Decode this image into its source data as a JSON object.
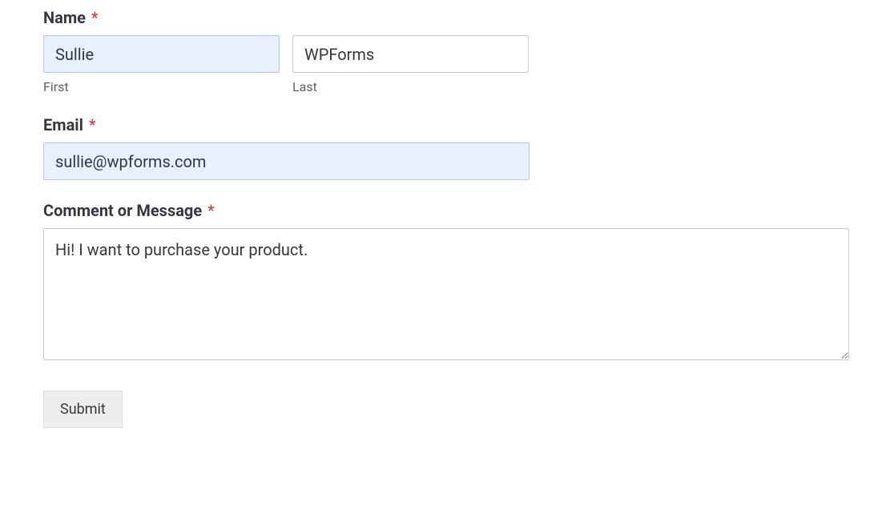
{
  "form": {
    "name": {
      "label": "Name",
      "required_marker": "*",
      "first": {
        "value": "Sullie",
        "sublabel": "First"
      },
      "last": {
        "value": "WPForms",
        "sublabel": "Last"
      }
    },
    "email": {
      "label": "Email",
      "required_marker": "*",
      "value": "sullie@wpforms.com"
    },
    "comment": {
      "label": "Comment or Message",
      "required_marker": "*",
      "value": "Hi! I want to purchase your product."
    },
    "submit": {
      "label": "Submit"
    }
  }
}
